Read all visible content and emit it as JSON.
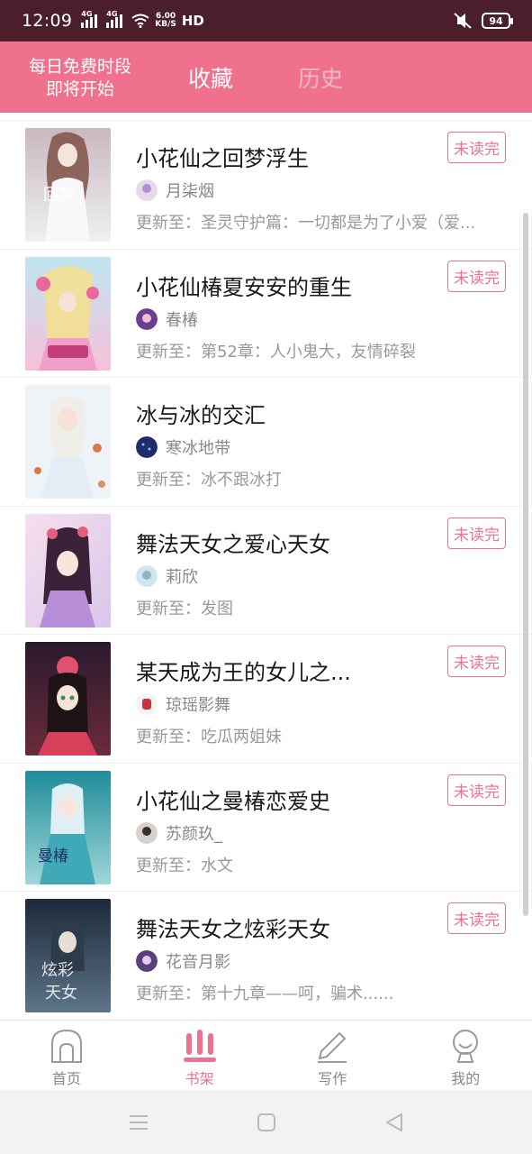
{
  "status_bar": {
    "time": "12:09",
    "network1": "4G",
    "network2": "4G",
    "speed_value": "6.00",
    "speed_unit": "KB/S",
    "hd": "HD",
    "battery": "94"
  },
  "header": {
    "promo_line1": "每日免费时段",
    "promo_line2": "即将开始",
    "tabs": [
      {
        "label": "收藏",
        "active": true
      },
      {
        "label": "历史",
        "active": false
      }
    ]
  },
  "books": [
    {
      "title": "小花仙之回梦浮生",
      "author": "月柒烟",
      "update": "更新至：圣灵守护篇：一切都是为了小爱（爱...",
      "badge": "未读完"
    },
    {
      "title": "小花仙椿夏安安的重生",
      "author": "春椿",
      "update": "更新至：第52章：人小鬼大，友情碎裂",
      "badge": "未读完"
    },
    {
      "title": "冰与冰的交汇",
      "author": "寒冰地带",
      "update": "更新至：冰不跟冰打",
      "badge": ""
    },
    {
      "title": "舞法天女之爱心天女",
      "author": "莉欣",
      "update": "更新至：发图",
      "badge": "未读完"
    },
    {
      "title": "某天成为王的女儿之...",
      "author": "琼瑶影舞",
      "update": "更新至：吃瓜两姐妹",
      "badge": "未读完"
    },
    {
      "title": "小花仙之曼椿恋爱史",
      "author": "苏颜玖_",
      "update": "更新至：水文",
      "badge": "未读完"
    },
    {
      "title": "舞法天女之炫彩天女",
      "author": "花音月影",
      "update": "更新至：第十九章——呵，骗术......",
      "badge": "未读完"
    }
  ],
  "bottom_nav": [
    {
      "label": "首页",
      "icon": "home-icon",
      "active": false
    },
    {
      "label": "书架",
      "icon": "bookshelf-icon",
      "active": true
    },
    {
      "label": "写作",
      "icon": "pen-icon",
      "active": false
    },
    {
      "label": "我的",
      "icon": "profile-icon",
      "active": false
    }
  ],
  "colors": {
    "accent": "#f0718e",
    "status_bar": "#4a1f2b",
    "inactive_tab": "#f8b9c7"
  }
}
